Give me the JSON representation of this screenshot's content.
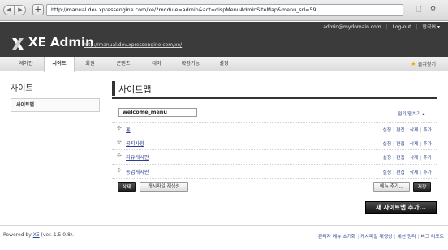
{
  "browser": {
    "url": "http://manual.dev.xpressengine.com/xe/?module=admin&act=dispMenuAdminSiteMap&menu_srl=59",
    "back_glyph": "◀",
    "forward_glyph": "▶",
    "new_tab_glyph": "+",
    "page_icon_glyph": "🗋",
    "gear_icon_glyph": "⚙"
  },
  "header": {
    "user_email": "admin@mydomain.com",
    "logout_label": "Log-out",
    "language_label": "한국어 ▾",
    "logo_text": "XE Admin",
    "site_url": "http://manual.dev.xpressengine.com/xe/"
  },
  "nav": {
    "items": [
      {
        "label": "제어판"
      },
      {
        "label": "사이트"
      },
      {
        "label": "회원"
      },
      {
        "label": "콘텐츠"
      },
      {
        "label": "테마"
      },
      {
        "label": "확장기능"
      },
      {
        "label": "설정"
      }
    ],
    "favorites_label": "즐겨찾기",
    "star_glyph": "★"
  },
  "sidebar": {
    "title": "사이트",
    "item_label": "사이트맵"
  },
  "content": {
    "title": "사이트맵",
    "menu_name": "welcome_menu",
    "toggle_label": "접기/펼치기 ▴",
    "node_glyph": "✣",
    "tree_rows": [
      {
        "label": "홈"
      },
      {
        "label": "공지사항"
      },
      {
        "label": "자유게시판"
      },
      {
        "label": "동업게시판"
      }
    ],
    "row_actions": {
      "settings": "설정",
      "edit": "편집",
      "delete": "삭제",
      "add": "추가"
    },
    "delete_button": "삭제",
    "regen_button": "캐시파일 재생성",
    "add_menu_button": "메뉴 추가...",
    "save_button": "저장",
    "new_sitemap_button": "새 사이트맵 추가..."
  },
  "footer": {
    "powered_prefix": "Powered by ",
    "powered_xe": "XE",
    "powered_suffix": " (ver. 1.5.0.8).",
    "links": [
      "관리자 메뉴 초기화",
      "캐시파일 재생성",
      "세션 정리",
      "버그 리포트"
    ]
  },
  "colors": {
    "header_bg": "#3b3b3b",
    "link": "#2d3f8f",
    "star": "#f0a800"
  }
}
